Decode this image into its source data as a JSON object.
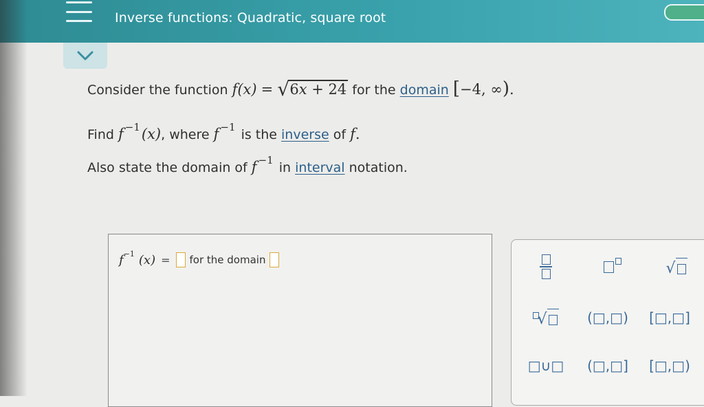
{
  "header": {
    "title": "Inverse functions: Quadratic, square root"
  },
  "question": {
    "line1_prefix": "Consider the function",
    "f_of_x": "f(x)",
    "equals": "=",
    "radicand_coef": "6",
    "radicand_var": "x",
    "radicand_rest": "+ 24",
    "line1_mid": "for the",
    "domain_link": "domain",
    "interval_open": "[",
    "interval_value": "−4, ∞",
    "interval_close": ")",
    "period": ".",
    "line2_prefix": "Find",
    "f_inv": "f",
    "inv_sup": "−1",
    "f_inv_arg": "(x)",
    "line2_mid": ", where",
    "line2_mid2": "is the",
    "inverse_link": "inverse",
    "line2_suffix": "of",
    "f_plain": "f",
    "line3_prefix": "Also state the domain of",
    "line3_mid": "in",
    "interval_link": "interval",
    "line3_suffix": "notation."
  },
  "answer": {
    "lhs_f": "f",
    "lhs_sup": "−1",
    "lhs_arg": "(x)",
    "eq": "=",
    "domain_label": "for the domain"
  },
  "keypad": {
    "keys": [
      {
        "id": "fraction",
        "label": ""
      },
      {
        "id": "exponent",
        "label": ""
      },
      {
        "id": "sqrt",
        "label": "√"
      },
      {
        "id": "nth-root",
        "label": "√"
      },
      {
        "id": "open-open",
        "label": "(□,□)"
      },
      {
        "id": "closed-closed",
        "label": "[□,□]"
      },
      {
        "id": "union",
        "label": "□∪□"
      },
      {
        "id": "open-closed",
        "label": "(□,□]"
      },
      {
        "id": "closed-open",
        "label": "[□,□)"
      }
    ]
  }
}
